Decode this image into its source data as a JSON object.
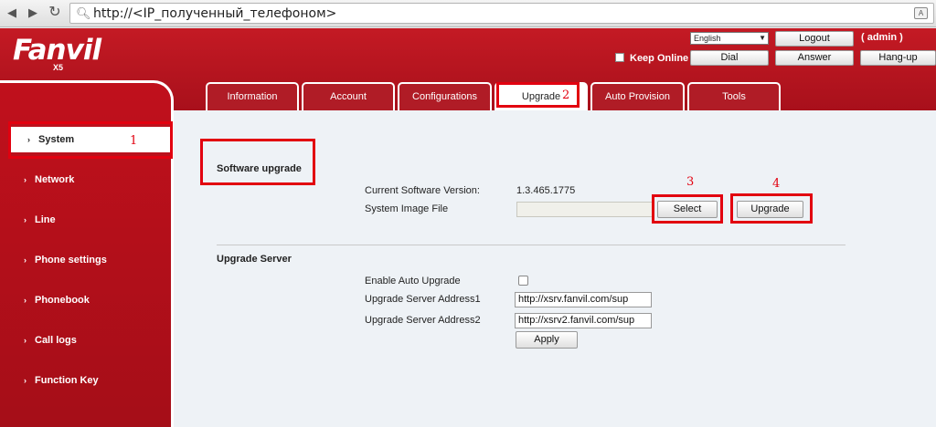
{
  "browser": {
    "url": "http://<IP_полученный_телефоном>"
  },
  "header": {
    "logo": "Fanvil",
    "model": "X5",
    "language": "English",
    "logout_label": "Logout",
    "user": "( admin )",
    "keep_online_label": "Keep Online",
    "dial_label": "Dial",
    "answer_label": "Answer",
    "hangup_label": "Hang-up"
  },
  "tabs": [
    {
      "label": "Information"
    },
    {
      "label": "Account"
    },
    {
      "label": "Configurations"
    },
    {
      "label": "Upgrade"
    },
    {
      "label": "Auto Provision"
    },
    {
      "label": "Tools"
    }
  ],
  "sidebar": {
    "items": [
      {
        "label": "System"
      },
      {
        "label": "Network"
      },
      {
        "label": "Line"
      },
      {
        "label": "Phone settings"
      },
      {
        "label": "Phonebook"
      },
      {
        "label": "Call logs"
      },
      {
        "label": "Function Key"
      }
    ]
  },
  "software_upgrade": {
    "title": "Software upgrade",
    "current_version_label": "Current Software Version:",
    "current_version": "1.3.465.1775",
    "image_file_label": "System Image File",
    "select_label": "Select",
    "upgrade_label": "Upgrade"
  },
  "upgrade_server": {
    "title": "Upgrade Server",
    "enable_auto_label": "Enable Auto Upgrade",
    "address1_label": "Upgrade Server Address1",
    "address1": "http://xsrv.fanvil.com/sup",
    "address2_label": "Upgrade Server Address2",
    "address2": "http://xsrv2.fanvil.com/sup",
    "apply_label": "Apply"
  },
  "annotations": [
    "1",
    "2",
    "3",
    "4"
  ],
  "colors": {
    "brand_red": "#b8141f",
    "annotation_red": "#e2000f"
  }
}
